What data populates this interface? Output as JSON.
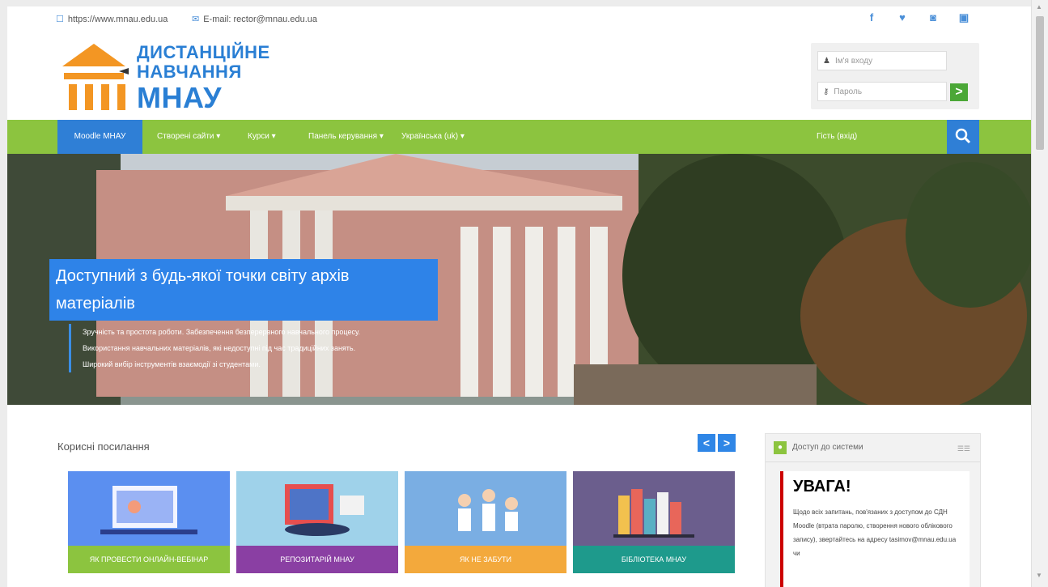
{
  "topbar": {
    "website": "https://www.mnau.edu.ua",
    "email": "E-mail: rector@mnau.edu.ua",
    "social": [
      "facebook-icon",
      "twitter-icon",
      "instagram-icon",
      "youtube-icon"
    ]
  },
  "logo": {
    "line1": "ДИСТАНЦІЙНЕ",
    "line2": "НАВЧАННЯ",
    "line3": "МНАУ"
  },
  "login": {
    "username_placeholder": "Ім'я входу",
    "password_placeholder": "Пароль",
    "submit_icon": ">"
  },
  "nav": {
    "items": [
      "Moodle МНАУ",
      "Створені сайти ▾",
      "Курси ▾",
      "Панель керування ▾",
      "Українська (uk) ▾"
    ],
    "right_text": "Гість (вхід)"
  },
  "hero": {
    "title": "Доступний з будь-якої точки світу архів матеріалів",
    "desc1": "Зручність та простота роботи. Забезпечення безперервного навчального процесу.",
    "desc2": "Використання навчальних матеріалів, які недоступні під час традиційних занять.",
    "desc3": "Широкий вибір інструментів взаємодії зі студентами."
  },
  "useful": {
    "title": "Корисні посилання",
    "prev": "<",
    "next": ">",
    "cards": [
      {
        "label": "ЯК ПРОВЕСТИ ОНЛАЙН-ВЕБІНАР",
        "color": "#8cc43f",
        "bg": "#5b8ff0"
      },
      {
        "label": "РЕПОЗИТАРІЙ МНАУ",
        "color": "#8a3fa3",
        "bg": "#9fd2ea"
      },
      {
        "label": "ЯК НЕ ЗАБУТИ",
        "color": "#f3a93c",
        "bg": "#7aaee3"
      },
      {
        "label": "БІБЛІОТЕКА МНАУ",
        "color": "#1e9a8c",
        "bg": "#6b5e8d"
      }
    ]
  },
  "side": {
    "title": "Доступ до системи",
    "notice_title": "УВАГА!",
    "notice_text": "Щодо всіх запитань, пов'язаних з доступом до СДН Moodle (втрата паролю, створення нового облікового запису), звертайтесь на адресу tasimov@mnau.edu.ua чи"
  }
}
